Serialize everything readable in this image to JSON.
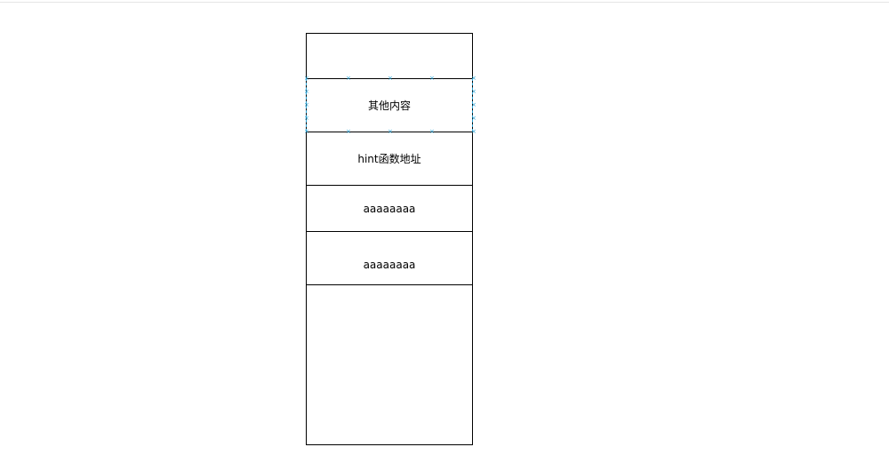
{
  "stack": {
    "cells": [
      {
        "label": ""
      },
      {
        "label": "其他内容"
      },
      {
        "label": "hint函数地址"
      },
      {
        "label": "aaaaaaaa"
      },
      {
        "label": "aaaaaaaa"
      },
      {
        "label": ""
      }
    ]
  },
  "selection": {
    "handle_glyph": "×",
    "handle_color": "#29a3d6"
  }
}
